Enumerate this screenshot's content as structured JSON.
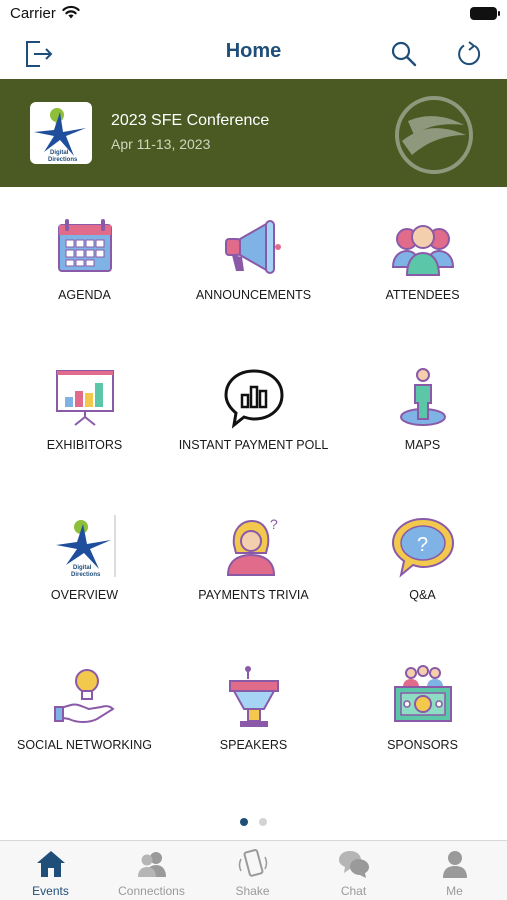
{
  "status": {
    "carrier": "Carrier"
  },
  "nav": {
    "title": "Home"
  },
  "banner": {
    "title": "2023 SFE Conference",
    "date": "Apr 11-13, 2023",
    "logo_text": "Digital Directions"
  },
  "grid": [
    {
      "label": "AGENDA",
      "icon": "calendar-icon"
    },
    {
      "label": "ANNOUNCEMENTS",
      "icon": "megaphone-icon"
    },
    {
      "label": "ATTENDEES",
      "icon": "people-icon"
    },
    {
      "label": "EXHIBITORS",
      "icon": "presentation-chart-icon"
    },
    {
      "label": "INSTANT PAYMENT POLL",
      "icon": "poll-bubble-icon"
    },
    {
      "label": "MAPS",
      "icon": "map-person-icon"
    },
    {
      "label": "OVERVIEW",
      "icon": "digital-directions-logo-icon"
    },
    {
      "label": "PAYMENTS TRIVIA",
      "icon": "trivia-person-icon"
    },
    {
      "label": "Q&A",
      "icon": "question-bubble-icon"
    },
    {
      "label": "SOCIAL NETWORKING",
      "icon": "lightbulb-hand-icon"
    },
    {
      "label": "SPEAKERS",
      "icon": "podium-icon"
    },
    {
      "label": "SPONSORS",
      "icon": "sponsors-icon"
    }
  ],
  "pager": {
    "pages": 2,
    "current": 1
  },
  "tabs": [
    {
      "label": "Events",
      "icon": "events-house-icon",
      "active": true
    },
    {
      "label": "Connections",
      "icon": "connections-icon",
      "active": false
    },
    {
      "label": "Shake",
      "icon": "shake-phone-icon",
      "active": false
    },
    {
      "label": "Chat",
      "icon": "chat-icon",
      "active": false
    },
    {
      "label": "Me",
      "icon": "me-person-icon",
      "active": false
    }
  ],
  "colors": {
    "brand": "#1f4e79",
    "banner": "#4a5a22",
    "inactive_tab": "#9a9a9a"
  }
}
